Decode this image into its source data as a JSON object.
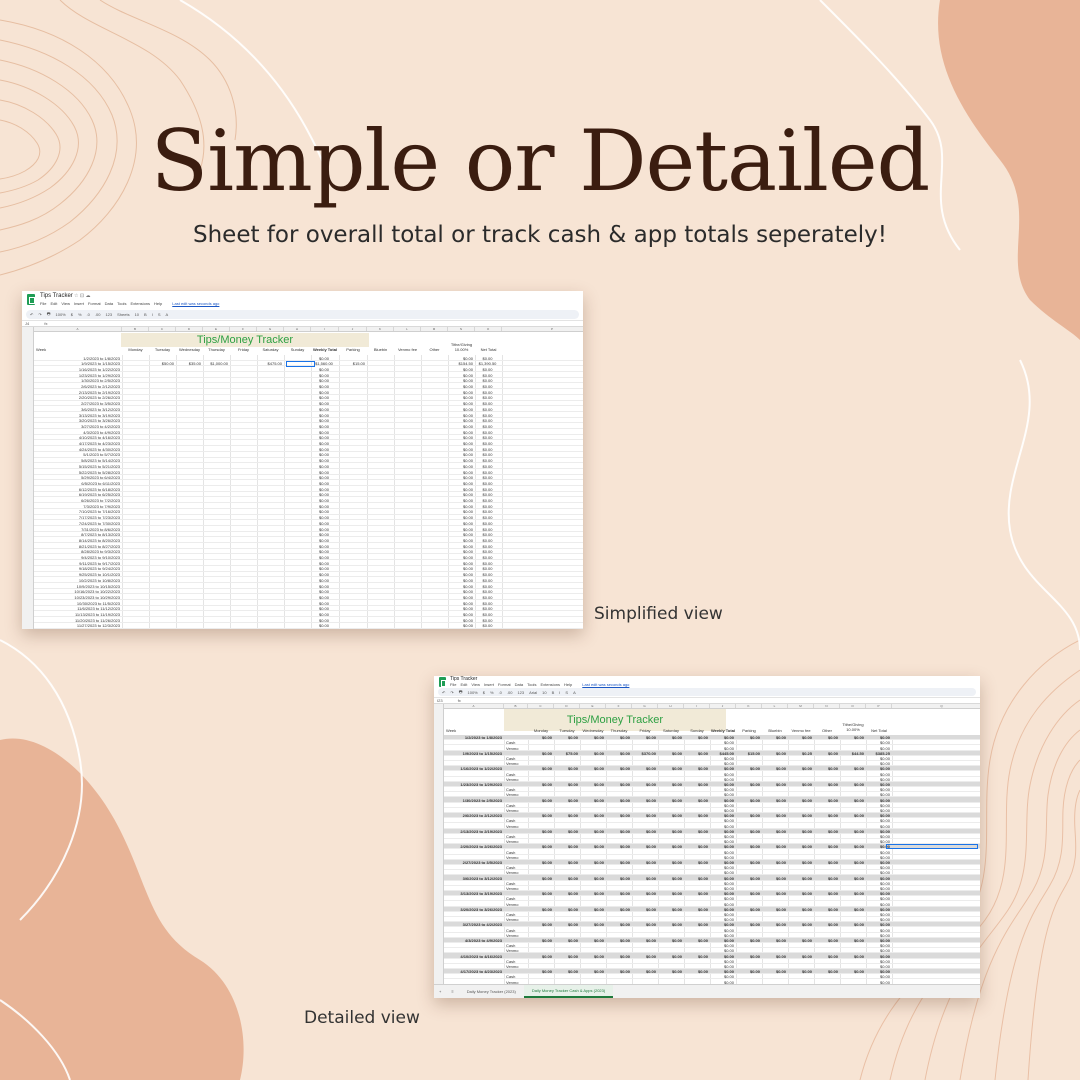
{
  "headline": "Simple or Detailed",
  "subheadline": "Sheet for overall total or track cash & app totals seperately!",
  "captions": {
    "simplified": "Simplified view",
    "detailed": "Detailed view"
  },
  "colors": {
    "background": "#f7e4d4",
    "wave": "#e8b497",
    "headline": "#3b1d10",
    "title_green": "#2ea043",
    "title_fill": "#f1ead7",
    "sheets_logo": "#1f9d55"
  },
  "simplified_sheet": {
    "doc_title": "Tips Tracker",
    "menu": [
      "File",
      "Edit",
      "View",
      "Insert",
      "Format",
      "Data",
      "Tools",
      "Extensions",
      "Help"
    ],
    "edit_notice": "Last edit was seconds ago",
    "toolbar": [
      "↶",
      "↷",
      "🖶",
      "100%",
      "$",
      "%",
      ".0",
      ".00",
      "123",
      "Sheets",
      "10",
      "B",
      "I",
      "S",
      "A"
    ],
    "cell_ref": "J4",
    "table_title": "Tips/Money Tracker",
    "columns": [
      "Week",
      "Monday",
      "Tuesday",
      "Wednesday",
      "Thursday",
      "Friday",
      "Saturday",
      "Sunday",
      "Weekly Total",
      "Parking",
      "Bluebin",
      "Venmo fee",
      "Other",
      "Tithe/Giving 10.00%",
      "Net Total"
    ],
    "rows": [
      {
        "week": "1/2/2023 to 1/8/2023",
        "mon": "",
        "tue": "",
        "wed": "",
        "thu": "",
        "sat": "",
        "total": "$0.00",
        "park": "",
        "tithe": "$0.00",
        "net": "$0.00"
      },
      {
        "week": "1/9/2023 to 1/15/2023",
        "mon": "",
        "tue": "$50.00",
        "wed": "$35.00",
        "thu": "$1,000.00",
        "sat": "$475.00",
        "total": "$1,560.00",
        "park": "$15.00",
        "tithe": "$154.50",
        "net": "$1,390.50"
      },
      {
        "week": "1/16/2023 to 1/22/2023",
        "total": "$0.00",
        "tithe": "$0.00",
        "net": "$0.00"
      },
      {
        "week": "1/23/2023 to 1/29/2023",
        "total": "$0.00",
        "tithe": "$0.00",
        "net": "$0.00"
      },
      {
        "week": "1/30/2023 to 2/5/2023",
        "total": "$0.00",
        "tithe": "$0.00",
        "net": "$0.00"
      },
      {
        "week": "2/6/2023 to 2/12/2023",
        "total": "$0.00",
        "tithe": "$0.00",
        "net": "$0.00"
      },
      {
        "week": "2/13/2023 to 2/19/2023",
        "total": "$0.00",
        "tithe": "$0.00",
        "net": "$0.00"
      },
      {
        "week": "2/20/2023 to 2/26/2023",
        "total": "$0.00",
        "tithe": "$0.00",
        "net": "$0.00"
      },
      {
        "week": "2/27/2023 to 3/5/2023",
        "total": "$0.00",
        "tithe": "$0.00",
        "net": "$0.00"
      },
      {
        "week": "3/6/2023 to 3/12/2023",
        "total": "$0.00",
        "tithe": "$0.00",
        "net": "$0.00"
      },
      {
        "week": "3/13/2023 to 3/19/2023",
        "total": "$0.00",
        "tithe": "$0.00",
        "net": "$0.00"
      },
      {
        "week": "3/20/2023 to 3/26/2023",
        "total": "$0.00",
        "tithe": "$0.00",
        "net": "$0.00"
      },
      {
        "week": "3/27/2023 to 4/2/2023",
        "total": "$0.00",
        "tithe": "$0.00",
        "net": "$0.00"
      },
      {
        "week": "4/3/2023 to 4/9/2023",
        "total": "$0.00",
        "tithe": "$0.00",
        "net": "$0.00"
      },
      {
        "week": "4/10/2023 to 4/16/2023",
        "total": "$0.00",
        "tithe": "$0.00",
        "net": "$0.00"
      },
      {
        "week": "4/17/2023 to 4/23/2023",
        "total": "$0.00",
        "tithe": "$0.00",
        "net": "$0.00"
      },
      {
        "week": "4/24/2023 to 4/30/2023",
        "total": "$0.00",
        "tithe": "$0.00",
        "net": "$0.00"
      },
      {
        "week": "5/1/2023 to 5/7/2023",
        "total": "$0.00",
        "tithe": "$0.00",
        "net": "$0.00"
      },
      {
        "week": "5/8/2023 to 5/14/2023",
        "total": "$0.00",
        "tithe": "$0.00",
        "net": "$0.00"
      },
      {
        "week": "5/15/2023 to 5/21/2023",
        "total": "$0.00",
        "tithe": "$0.00",
        "net": "$0.00"
      },
      {
        "week": "5/22/2023 to 5/28/2023",
        "total": "$0.00",
        "tithe": "$0.00",
        "net": "$0.00"
      },
      {
        "week": "5/29/2023 to 6/4/2023",
        "total": "$0.00",
        "tithe": "$0.00",
        "net": "$0.00"
      },
      {
        "week": "6/5/2023 to 6/11/2023",
        "total": "$0.00",
        "tithe": "$0.00",
        "net": "$0.00"
      },
      {
        "week": "6/12/2023 to 6/18/2023",
        "total": "$0.00",
        "tithe": "$0.00",
        "net": "$0.00"
      },
      {
        "week": "6/19/2023 to 6/25/2023",
        "total": "$0.00",
        "tithe": "$0.00",
        "net": "$0.00"
      },
      {
        "week": "6/26/2023 to 7/2/2023",
        "total": "$0.00",
        "tithe": "$0.00",
        "net": "$0.00"
      },
      {
        "week": "7/3/2023 to 7/9/2023",
        "total": "$0.00",
        "tithe": "$0.00",
        "net": "$0.00"
      },
      {
        "week": "7/10/2023 to 7/16/2023",
        "total": "$0.00",
        "tithe": "$0.00",
        "net": "$0.00"
      },
      {
        "week": "7/17/2023 to 7/23/2023",
        "total": "$0.00",
        "tithe": "$0.00",
        "net": "$0.00"
      },
      {
        "week": "7/24/2023 to 7/30/2023",
        "total": "$0.00",
        "tithe": "$0.00",
        "net": "$0.00"
      },
      {
        "week": "7/31/2023 to 8/6/2023",
        "total": "$0.00",
        "tithe": "$0.00",
        "net": "$0.00"
      },
      {
        "week": "8/7/2023 to 8/13/2023",
        "total": "$0.00",
        "tithe": "$0.00",
        "net": "$0.00"
      },
      {
        "week": "8/14/2023 to 8/20/2023",
        "total": "$0.00",
        "tithe": "$0.00",
        "net": "$0.00"
      },
      {
        "week": "8/21/2023 to 8/27/2023",
        "total": "$0.00",
        "tithe": "$0.00",
        "net": "$0.00"
      },
      {
        "week": "8/28/2023 to 9/3/2023",
        "total": "$0.00",
        "tithe": "$0.00",
        "net": "$0.00"
      },
      {
        "week": "9/4/2023 to 9/10/2023",
        "total": "$0.00",
        "tithe": "$0.00",
        "net": "$0.00"
      },
      {
        "week": "9/11/2023 to 9/17/2023",
        "total": "$0.00",
        "tithe": "$0.00",
        "net": "$0.00"
      },
      {
        "week": "9/18/2023 to 9/24/2023",
        "total": "$0.00",
        "tithe": "$0.00",
        "net": "$0.00"
      },
      {
        "week": "9/25/2023 to 10/1/2023",
        "total": "$0.00",
        "tithe": "$0.00",
        "net": "$0.00"
      },
      {
        "week": "10/2/2023 to 10/8/2023",
        "total": "$0.00",
        "tithe": "$0.00",
        "net": "$0.00"
      },
      {
        "week": "10/9/2023 to 10/15/2023",
        "total": "$0.00",
        "tithe": "$0.00",
        "net": "$0.00"
      },
      {
        "week": "10/16/2023 to 10/22/2023",
        "total": "$0.00",
        "tithe": "$0.00",
        "net": "$0.00"
      },
      {
        "week": "10/23/2023 to 10/29/2023",
        "total": "$0.00",
        "tithe": "$0.00",
        "net": "$0.00"
      },
      {
        "week": "10/30/2023 to 11/5/2023",
        "total": "$0.00",
        "tithe": "$0.00",
        "net": "$0.00"
      },
      {
        "week": "11/6/2023 to 11/12/2023",
        "total": "$0.00",
        "tithe": "$0.00",
        "net": "$0.00"
      },
      {
        "week": "11/13/2023 to 11/19/2023",
        "total": "$0.00",
        "tithe": "$0.00",
        "net": "$0.00"
      },
      {
        "week": "11/20/2023 to 11/26/2023",
        "total": "$0.00",
        "tithe": "$0.00",
        "net": "$0.00"
      },
      {
        "week": "11/27/2023 to 12/3/2023",
        "total": "$0.00",
        "tithe": "$0.00",
        "net": "$0.00"
      }
    ]
  },
  "detailed_sheet": {
    "doc_title": "Tips Tracker",
    "menu": [
      "File",
      "Edit",
      "View",
      "Insert",
      "Format",
      "Data",
      "Tools",
      "Extensions",
      "Help"
    ],
    "edit_notice": "Last edit was seconds ago",
    "toolbar": [
      "↶",
      "↷",
      "🖶",
      "100%",
      "$",
      "%",
      ".0",
      ".00",
      "123",
      "Arial",
      "10",
      "B",
      "I",
      "S",
      "A"
    ],
    "cell_ref": "I23",
    "table_title": "Tips/Money Tracker",
    "columns": [
      "Week",
      "",
      "Monday",
      "Tuesday",
      "Wednesday",
      "Thursday",
      "Friday",
      "Saturday",
      "Sunday",
      "Weekly Total",
      "Parking",
      "Bluebin",
      "Venmo fee",
      "Other",
      "Tithe/Giving 10.00%",
      "Net Total"
    ],
    "groups": [
      {
        "week": "1/2/2023 to 1/8/2023",
        "vals": [
          "$0.00",
          "$0.00",
          "$0.00",
          "$0.00",
          "$0.00",
          "$0.00",
          "$0.00",
          "$0.00",
          "$0.00",
          "$0.00",
          "$0.00",
          "$0.00",
          "$0.00",
          "$0.00"
        ]
      },
      {
        "week": "1/9/2023 to 1/15/2023",
        "vals": [
          "$0.00",
          "$75.00",
          "$0.00",
          "$0.00",
          "$370.00",
          "$0.00",
          "$0.00",
          "$445.00",
          "$15.00",
          "$0.00",
          "$0.25",
          "$0.00",
          "$44.50",
          "$385.25"
        ]
      },
      {
        "week": "1/16/2023 to 1/22/2023",
        "vals": [
          "$0.00",
          "$0.00",
          "$0.00",
          "$0.00",
          "$0.00",
          "$0.00",
          "$0.00",
          "$0.00",
          "$0.00",
          "$0.00",
          "$0.00",
          "$0.00",
          "$0.00",
          "$0.00"
        ]
      },
      {
        "week": "1/23/2023 to 1/29/2023",
        "vals": [
          "$0.00",
          "$0.00",
          "$0.00",
          "$0.00",
          "$0.00",
          "$0.00",
          "$0.00",
          "$0.00",
          "$0.00",
          "$0.00",
          "$0.00",
          "$0.00",
          "$0.00",
          "$0.00"
        ]
      },
      {
        "week": "1/30/2023 to 2/5/2023",
        "vals": [
          "$0.00",
          "$0.00",
          "$0.00",
          "$0.00",
          "$0.00",
          "$0.00",
          "$0.00",
          "$0.00",
          "$0.00",
          "$0.00",
          "$0.00",
          "$0.00",
          "$0.00",
          "$0.00"
        ]
      },
      {
        "week": "2/6/2023 to 2/12/2023",
        "vals": [
          "$0.00",
          "$0.00",
          "$0.00",
          "$0.00",
          "$0.00",
          "$0.00",
          "$0.00",
          "$0.00",
          "$0.00",
          "$0.00",
          "$0.00",
          "$0.00",
          "$0.00",
          "$0.00"
        ]
      },
      {
        "week": "2/13/2023 to 2/19/2023",
        "vals": [
          "$0.00",
          "$0.00",
          "$0.00",
          "$0.00",
          "$0.00",
          "$0.00",
          "$0.00",
          "$0.00",
          "$0.00",
          "$0.00",
          "$0.00",
          "$0.00",
          "$0.00",
          "$0.00"
        ]
      },
      {
        "week": "2/20/2023 to 2/26/2023",
        "vals": [
          "$0.00",
          "$0.00",
          "$0.00",
          "$0.00",
          "$0.00",
          "$0.00",
          "$0.00",
          "$0.00",
          "$0.00",
          "$0.00",
          "$0.00",
          "$0.00",
          "$0.00",
          "$0.00"
        ]
      },
      {
        "week": "2/27/2023 to 3/5/2023",
        "vals": [
          "$0.00",
          "$0.00",
          "$0.00",
          "$0.00",
          "$0.00",
          "$0.00",
          "$0.00",
          "$0.00",
          "$0.00",
          "$0.00",
          "$0.00",
          "$0.00",
          "$0.00",
          "$0.00"
        ]
      },
      {
        "week": "3/6/2023 to 3/12/2023",
        "vals": [
          "$0.00",
          "$0.00",
          "$0.00",
          "$0.00",
          "$0.00",
          "$0.00",
          "$0.00",
          "$0.00",
          "$0.00",
          "$0.00",
          "$0.00",
          "$0.00",
          "$0.00",
          "$0.00"
        ]
      },
      {
        "week": "3/13/2023 to 3/19/2023",
        "vals": [
          "$0.00",
          "$0.00",
          "$0.00",
          "$0.00",
          "$0.00",
          "$0.00",
          "$0.00",
          "$0.00",
          "$0.00",
          "$0.00",
          "$0.00",
          "$0.00",
          "$0.00",
          "$0.00"
        ]
      },
      {
        "week": "3/20/2023 to 3/26/2023",
        "vals": [
          "$0.00",
          "$0.00",
          "$0.00",
          "$0.00",
          "$0.00",
          "$0.00",
          "$0.00",
          "$0.00",
          "$0.00",
          "$0.00",
          "$0.00",
          "$0.00",
          "$0.00",
          "$0.00"
        ]
      },
      {
        "week": "3/27/2023 to 4/2/2023",
        "vals": [
          "$0.00",
          "$0.00",
          "$0.00",
          "$0.00",
          "$0.00",
          "$0.00",
          "$0.00",
          "$0.00",
          "$0.00",
          "$0.00",
          "$0.00",
          "$0.00",
          "$0.00",
          "$0.00"
        ]
      },
      {
        "week": "4/3/2023 to 4/9/2023",
        "vals": [
          "$0.00",
          "$0.00",
          "$0.00",
          "$0.00",
          "$0.00",
          "$0.00",
          "$0.00",
          "$0.00",
          "$0.00",
          "$0.00",
          "$0.00",
          "$0.00",
          "$0.00",
          "$0.00"
        ]
      },
      {
        "week": "4/10/2023 to 4/16/2023",
        "vals": [
          "$0.00",
          "$0.00",
          "$0.00",
          "$0.00",
          "$0.00",
          "$0.00",
          "$0.00",
          "$0.00",
          "$0.00",
          "$0.00",
          "$0.00",
          "$0.00",
          "$0.00",
          "$0.00"
        ]
      },
      {
        "week": "4/17/2023 to 4/23/2023",
        "vals": [
          "$0.00",
          "$0.00",
          "$0.00",
          "$0.00",
          "$0.00",
          "$0.00",
          "$0.00",
          "$0.00",
          "$0.00",
          "$0.00",
          "$0.00",
          "$0.00",
          "$0.00",
          "$0.00"
        ]
      }
    ],
    "sub_labels": [
      "Cash",
      "Venmo"
    ],
    "sub_value": "$0.00",
    "tabs": [
      "Daily Money Tracker (2023)",
      "Daily Money Tracker Cash & Apps (2023)"
    ]
  }
}
